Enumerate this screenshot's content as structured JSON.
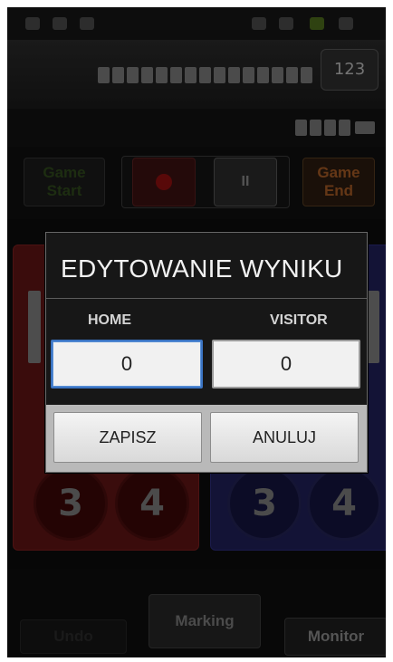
{
  "dialog": {
    "title": "EDYTOWANIE WYNIKU",
    "home_label": "HOME",
    "visitor_label": "VISITOR",
    "home_score": "0",
    "visitor_score": "0",
    "save_label": "ZAPISZ",
    "cancel_label": "ANULUJ"
  },
  "background": {
    "controls": {
      "start_label": "Game Start",
      "end_label": "Game End",
      "record_icon": "record-icon",
      "pause_icon": "pause-icon",
      "pause_glyph": "II"
    },
    "settings_icon": "settings-gear-icon",
    "settings_glyph": "123",
    "home_buttons": [
      "3",
      "4"
    ],
    "visitor_buttons": [
      "3",
      "4"
    ],
    "bottom": {
      "undo_label": "Undo",
      "marking_label": "Marking",
      "monitor_label": "Monitor"
    },
    "colors": {
      "home_panel": "#5e1414",
      "visitor_panel": "#1f1f58",
      "game_end": "#a35a25",
      "dialog_focus": "#3b74c2"
    }
  }
}
